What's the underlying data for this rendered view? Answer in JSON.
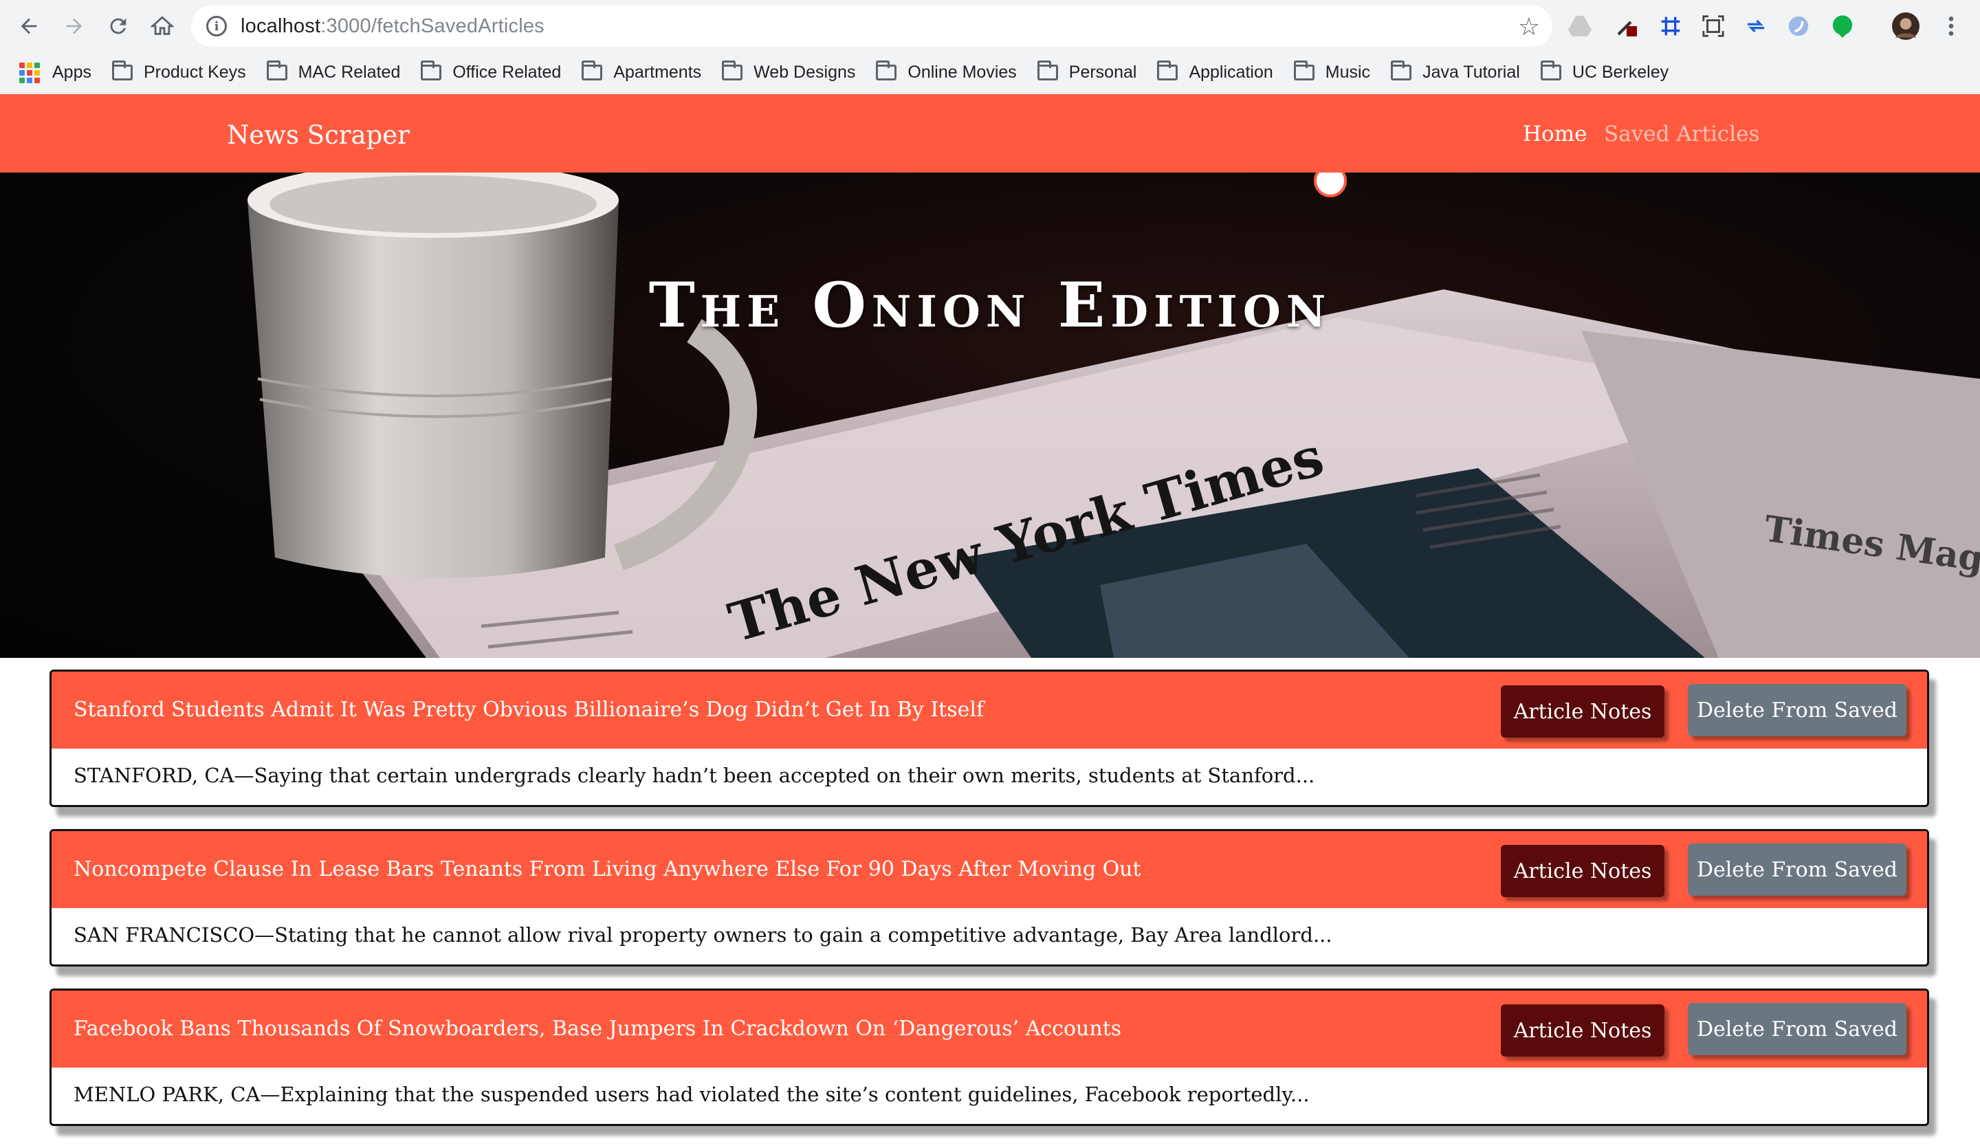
{
  "browser": {
    "url_host": "localhost",
    "url_rest": ":3000/fetchSavedArticles",
    "bookmarks": [
      {
        "label": "Apps"
      },
      {
        "label": "Product Keys"
      },
      {
        "label": "MAC Related"
      },
      {
        "label": "Office Related"
      },
      {
        "label": "Apartments"
      },
      {
        "label": "Web Designs"
      },
      {
        "label": "Online Movies"
      },
      {
        "label": "Personal"
      },
      {
        "label": "Application"
      },
      {
        "label": "Music"
      },
      {
        "label": "Java Tutorial"
      },
      {
        "label": "UC Berkeley"
      }
    ]
  },
  "navbar": {
    "brand": "News Scraper",
    "links": [
      {
        "label": "Home",
        "active": true
      },
      {
        "label": "Saved Articles",
        "active": false
      }
    ]
  },
  "hero": {
    "title": "The Onion Edition",
    "newspaper_masthead": "The New York Times"
  },
  "articles": [
    {
      "title": "Stanford Students Admit It Was Pretty Obvious Billionaire’s Dog Didn’t Get In By Itself",
      "summary": "STANFORD, CA—Saying that certain undergrads clearly hadn’t been accepted on their own merits, students at Stanford...",
      "notes_label": "Article Notes",
      "delete_label": "Delete From Saved"
    },
    {
      "title": "Noncompete Clause In Lease Bars Tenants From Living Anywhere Else For 90 Days After Moving Out",
      "summary": "SAN FRANCISCO—Stating that he cannot allow rival property owners to gain a competitive advantage, Bay Area landlord...",
      "notes_label": "Article Notes",
      "delete_label": "Delete From Saved"
    },
    {
      "title": "Facebook Bans Thousands Of Snowboarders, Base Jumpers In Crackdown On ‘Dangerous’ Accounts",
      "summary": "MENLO PARK, CA—Explaining that the suspended users had violated the site’s content guidelines, Facebook reportedly...",
      "notes_label": "Article Notes",
      "delete_label": "Delete From Saved"
    }
  ],
  "colors": {
    "accent": "#ff5a3f",
    "notes_button": "#5a0a0a",
    "delete_button": "#6b7780"
  }
}
